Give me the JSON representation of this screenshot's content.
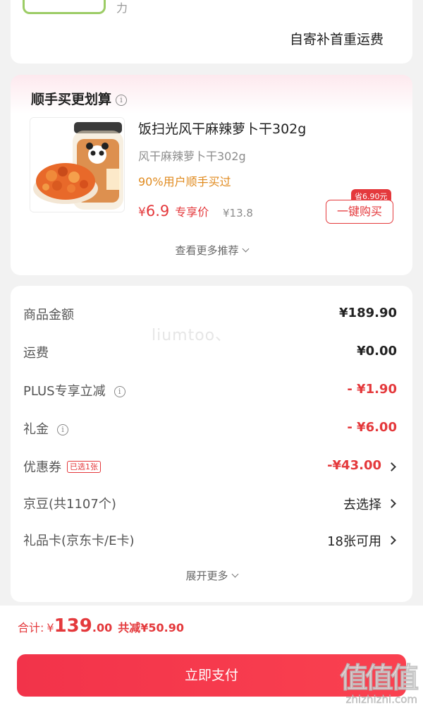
{
  "shipping_card": {
    "fragment": "力",
    "note": "自寄补首重运费"
  },
  "recommend": {
    "title": "顺手买更划算",
    "product": {
      "name": "饭扫光风干麻辣萝卜干302g",
      "subtitle": "风干麻辣萝卜干302g",
      "popularity": "90%用户顺手买过",
      "price_currency": "¥",
      "price": "6.9",
      "price_tag": "专享价",
      "original_price": "¥13.8",
      "save_badge": "省6.90元",
      "buy_label": "一键购买"
    },
    "more_label": "查看更多推荐"
  },
  "summary": {
    "watermark": "liumtoo、",
    "rows": [
      {
        "label": "商品金额",
        "value": "¥189.90"
      },
      {
        "label": "运费",
        "value": "¥0.00"
      },
      {
        "label": "PLUS专享立减",
        "value": "- ¥1.90"
      },
      {
        "label": "礼金",
        "value": "- ¥6.00"
      },
      {
        "label": "优惠券",
        "badge": "已选1张",
        "value": "-¥43.00"
      },
      {
        "label": "京豆(共1107个)",
        "value": "去选择"
      },
      {
        "label": "礼品卡(京东卡/E卡)",
        "value": "18张可用"
      }
    ],
    "expand_label": "展开更多"
  },
  "bottom": {
    "total_label": "合计:",
    "currency": "¥",
    "total_int": "139",
    "total_dec": ".00",
    "discount": "共减¥50.90",
    "pay_label": "立即支付",
    "logo": "值值值",
    "logo_url": "zhizhizhi.com"
  },
  "colors": {
    "accent": "#e4393c",
    "popularity": "#e08a1e"
  }
}
